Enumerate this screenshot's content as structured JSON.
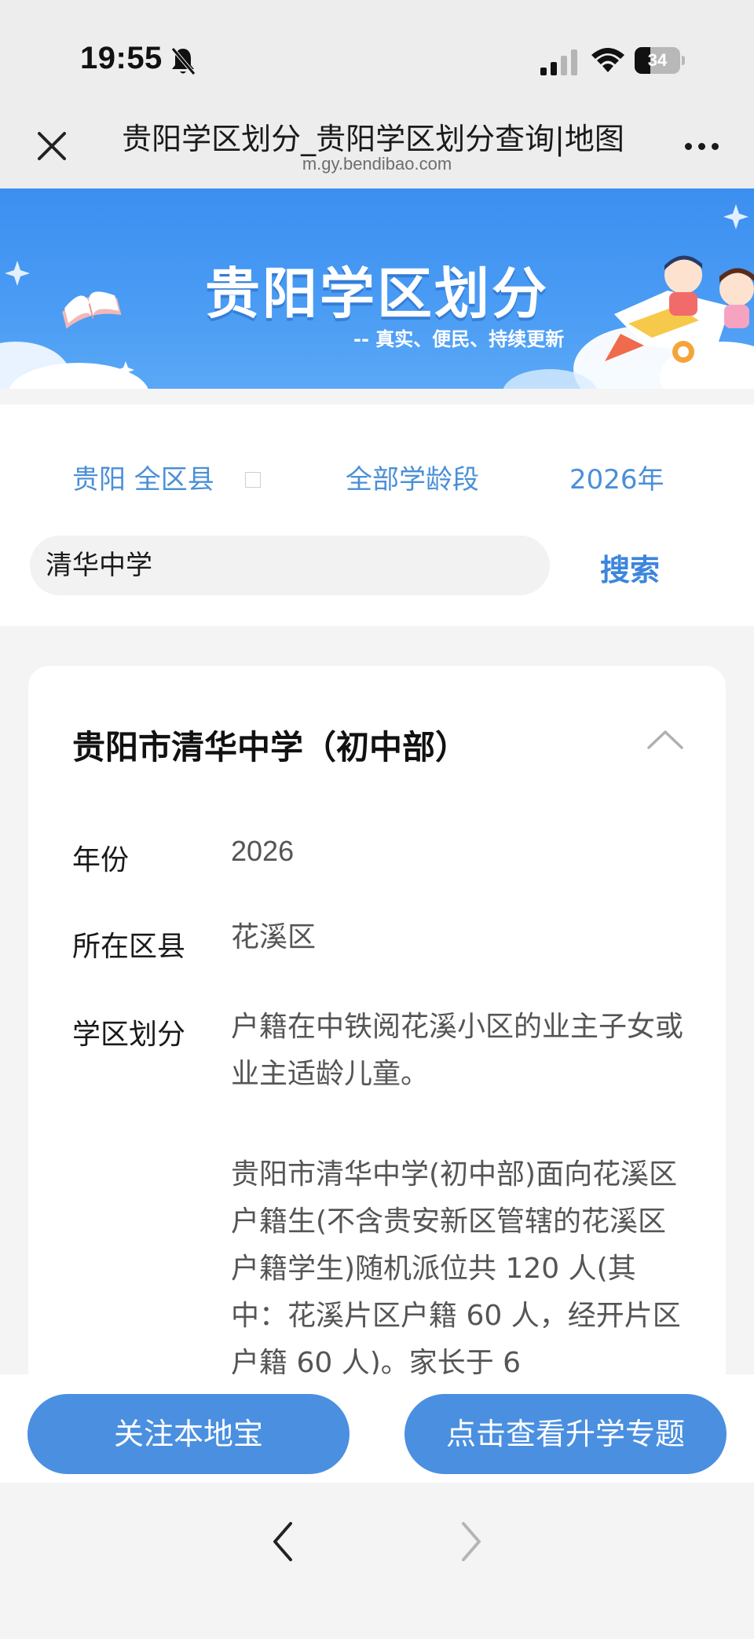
{
  "status_bar": {
    "time": "19:55",
    "battery_level": "34",
    "icons": [
      "bell-off-icon",
      "cellular-signal-icon",
      "wifi-icon",
      "battery-icon"
    ]
  },
  "browser": {
    "page_title": "贵阳学区划分_贵阳学区划分查询|地图",
    "url": "m.gy.bendibao.com"
  },
  "banner": {
    "title": "贵阳学区划分",
    "subtitle": "-- 真实、便民、持续更新"
  },
  "filters": {
    "district": "贵阳 全区县",
    "age_group": "全部学龄段",
    "year": "2026年"
  },
  "search": {
    "value": "清华中学",
    "button_label": "搜索"
  },
  "result": {
    "school_name": "贵阳市清华中学（初中部）",
    "year_label": "年份",
    "year_value": "2026",
    "district_label": "所在区县",
    "district_value": "花溪区",
    "zone_label": "学区划分",
    "zone_text_1": "户籍在中铁阅花溪小区的业主子女或业主适龄儿童。",
    "zone_text_2": "贵阳市清华中学(初中部)面向花溪区户籍生(不含贵安新区管辖的花溪区户籍学生)随机派位共 120 人(其中：花溪片区户籍 60 人，经开片区户籍 60 人)。家长于 6"
  },
  "actions": {
    "follow_label": "关注本地宝",
    "topic_label": "点击查看升学专题"
  },
  "colors": {
    "accent": "#4a8fe0",
    "banner": "#3c8ff0",
    "link": "#4a8fd8"
  }
}
